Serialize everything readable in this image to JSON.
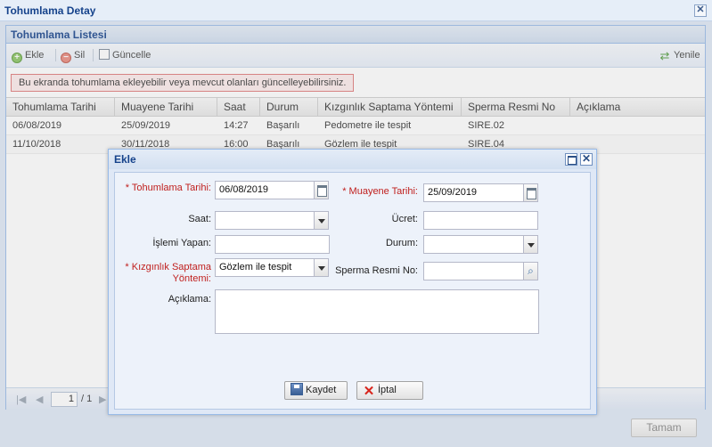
{
  "window": {
    "title": "Tohumlama Detay",
    "close_icon": "close-icon"
  },
  "panel": {
    "title": "Tohumlama Listesi"
  },
  "toolbar": {
    "add_label": "Ekle",
    "delete_label": "Sil",
    "update_label": "Güncelle",
    "refresh_label": "Yenile"
  },
  "info_message": "Bu ekranda tohumlama ekleyebilir veya mevcut olanları güncelleyebilirsiniz.",
  "grid": {
    "columns": [
      "Tohumlama Tarihi",
      "Muayene Tarihi",
      "Saat",
      "Durum",
      "Kızgınlık Saptama Yöntemi",
      "Sperma Resmi No",
      "Açıklama"
    ],
    "rows": [
      [
        "06/08/2019",
        "25/09/2019",
        "14:27",
        "Başarılı",
        "Pedometre ile tespit",
        "SIRE.02",
        ""
      ],
      [
        "11/10/2018",
        "30/11/2018",
        "16:00",
        "Başarılı",
        "Gözlem ile tespit",
        "SIRE.04",
        ""
      ]
    ]
  },
  "pager": {
    "page_value": "1",
    "page_total": "/ 1"
  },
  "footer": {
    "ok_label": "Tamam"
  },
  "modal": {
    "title": "Ekle",
    "labels": {
      "tohumlama_tarihi": "* Tohumlama Tarihi:",
      "muayene_tarihi": "* Muayene Tarihi:",
      "saat": "Saat:",
      "ucret": "Ücret:",
      "islemi_yapan": "İşlemi Yapan:",
      "durum": "Durum:",
      "kizginlik": "* Kızgınlık Saptama Yöntemi:",
      "sperma": "Sperma Resmi No:",
      "aciklama": "Açıklama:"
    },
    "values": {
      "tohumlama_tarihi": "06/08/2019",
      "muayene_tarihi": "25/09/2019",
      "saat": "",
      "ucret": "",
      "islemi_yapan": "",
      "durum": "",
      "kizginlik": "Gözlem ile tespit",
      "sperma": "",
      "aciklama": ""
    },
    "save_label": "Kaydet",
    "cancel_label": "İptal"
  }
}
